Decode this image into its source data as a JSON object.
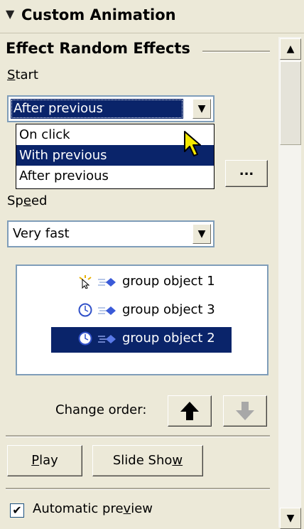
{
  "pane": {
    "title": "Custom Animation"
  },
  "effect": {
    "heading": "Effect Random Effects"
  },
  "start": {
    "label_prefix": "",
    "label_mnemonic": "S",
    "label_rest": "tart",
    "value": "After previous",
    "options": [
      "On click",
      "With previous",
      "After previous"
    ],
    "highlighted_option": "With previous"
  },
  "ellipsis_button": {
    "label": "..."
  },
  "speed": {
    "label_prefix": "Sp",
    "label_mnemonic": "e",
    "label_rest": "ed",
    "value": "Very fast"
  },
  "animation_list": {
    "items": [
      {
        "label": "group object 1",
        "trigger_icon": "click-trigger-icon",
        "effect_icon": "random-effect-icon",
        "selected": false
      },
      {
        "label": "group object 3",
        "trigger_icon": "clock-icon",
        "effect_icon": "random-effect-icon",
        "selected": false
      },
      {
        "label": "group object 2",
        "trigger_icon": "clock-icon",
        "effect_icon": "random-effect-icon",
        "selected": true
      }
    ]
  },
  "order": {
    "label": "Change order:"
  },
  "play_button": {
    "label_mnemonic": "P",
    "label_rest": "lay"
  },
  "slideshow_button": {
    "label_prefix": "Slide Sho",
    "label_mnemonic": "w",
    "label_rest": ""
  },
  "preview": {
    "label_prefix": "Automatic pre",
    "label_mnemonic": "v",
    "label_rest": "iew",
    "checked": true
  },
  "colors": {
    "selection": "#0a246a",
    "panel": "#ece9d8",
    "field_border": "#7f9db9"
  }
}
